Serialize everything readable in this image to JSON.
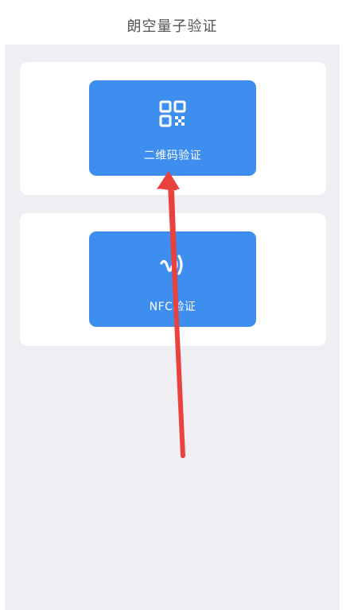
{
  "header": {
    "title": "朗空量子验证"
  },
  "options": {
    "qr": {
      "label": "二维码验证",
      "icon": "qr-code-icon"
    },
    "nfc": {
      "label": "NFC验证",
      "icon": "nfc-icon"
    }
  },
  "colors": {
    "accent": "#3e8ef0",
    "background": "#efeef3",
    "annotation_arrow": "#e8413e"
  }
}
